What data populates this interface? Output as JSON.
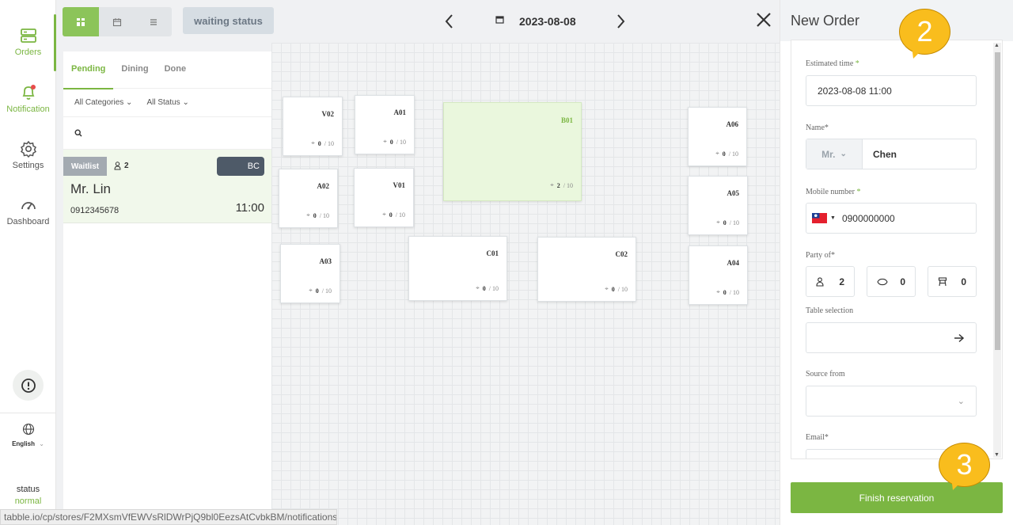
{
  "nav": {
    "items": [
      {
        "label": "Orders",
        "icon": "orders-icon",
        "active": true
      },
      {
        "label": "Notification",
        "icon": "bell-icon",
        "active": false
      },
      {
        "label": "Settings",
        "icon": "gear-icon",
        "active": false
      },
      {
        "label": "Dashboard",
        "icon": "gauge-icon",
        "active": false
      }
    ],
    "language": "English",
    "status_label": "status",
    "status_value": "normal"
  },
  "toolbar": {
    "waiting_status": "waiting status",
    "date": "2023-08-08"
  },
  "list": {
    "tabs": [
      "Pending",
      "Dining",
      "Done"
    ],
    "filters": {
      "category": "All Categories",
      "status": "All Status"
    },
    "order": {
      "badge": "Waitlist",
      "party": "2",
      "pill": "BC",
      "name": "Mr. Lin",
      "phone": "0912345678",
      "time": "11:00"
    }
  },
  "tables": [
    {
      "name": "V02",
      "seated": "0",
      "cap": "/ 10"
    },
    {
      "name": "A01",
      "seated": "0",
      "cap": "/ 10"
    },
    {
      "name": "B01",
      "seated": "2",
      "cap": "/ 10",
      "selected": true
    },
    {
      "name": "A06",
      "seated": "0",
      "cap": "/ 10"
    },
    {
      "name": "A02",
      "seated": "0",
      "cap": "/ 10"
    },
    {
      "name": "V01",
      "seated": "0",
      "cap": "/ 10"
    },
    {
      "name": "A05",
      "seated": "0",
      "cap": "/ 10"
    },
    {
      "name": "A03",
      "seated": "0",
      "cap": "/ 10"
    },
    {
      "name": "C01",
      "seated": "0",
      "cap": "/ 10"
    },
    {
      "name": "C02",
      "seated": "0",
      "cap": "/ 10"
    },
    {
      "name": "A04",
      "seated": "0",
      "cap": "/ 10"
    }
  ],
  "new_order": {
    "title": "New Order",
    "estimated_time_label": "Estimated time",
    "estimated_time_value": "2023-08-08 11:00",
    "name_label": "Name*",
    "title_select": "Mr.",
    "name_value": "Chen",
    "mobile_label": "Mobile number",
    "mobile_value": "0900000000",
    "party_label": "Party of*",
    "party_adults": "2",
    "party_children": "0",
    "party_seats": "0",
    "table_label": "Table selection",
    "source_label": "Source from",
    "email_label": "Email*",
    "required_mark": "*",
    "finish_label": "Finish reservation"
  },
  "callouts": [
    "2",
    "3"
  ],
  "status_url": "tabble.io/cp/stores/F2MXsmVfEWVsRlDWrPjQ9bl0EezsAtCvbkBM/notifications",
  "colors": {
    "accent": "#7bb642",
    "callout": "#f9bd1d",
    "dark": "#4e5a68"
  }
}
